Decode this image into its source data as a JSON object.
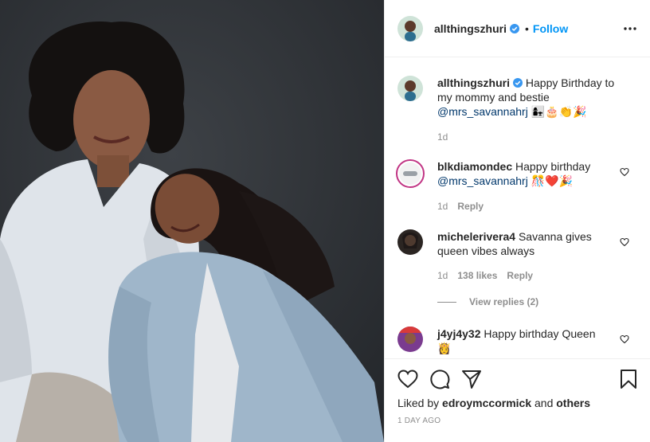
{
  "post": {
    "author": "allthingszhuri",
    "follow_label": "Follow",
    "dot": "•",
    "photo_alt": "",
    "more_icon": "more-options-icon"
  },
  "caption": {
    "username": "allthingszhuri",
    "text": "Happy Birthday to my mommy and bestie",
    "mention": "@mrs_savannahrj",
    "emojis": "👩‍👧🎂👏🎉",
    "time": "1d"
  },
  "comments": [
    {
      "username": "blkdiamondec",
      "text": "Happy birthday",
      "mention": "@mrs_savannahrj",
      "emojis": "🎊❤️🎉",
      "time": "1d",
      "reply_label": "Reply"
    },
    {
      "username": "michelerivera4",
      "text": "Savanna gives queen vibes always",
      "time": "1d",
      "likes": "138 likes",
      "reply_label": "Reply",
      "view_replies": "View replies (2)"
    },
    {
      "username": "j4yj4y32",
      "text": "Happy birthday Queen",
      "emojis": "👸"
    }
  ],
  "footer": {
    "liked_prefix": "Liked by",
    "liked_user": "edroymccormick",
    "liked_and": "and",
    "liked_others": "others",
    "timestamp": "1 DAY AGO"
  },
  "colors": {
    "link": "#0095f6",
    "mention": "#00376b",
    "muted": "#8e8e8e",
    "verified": "#3897f0"
  }
}
